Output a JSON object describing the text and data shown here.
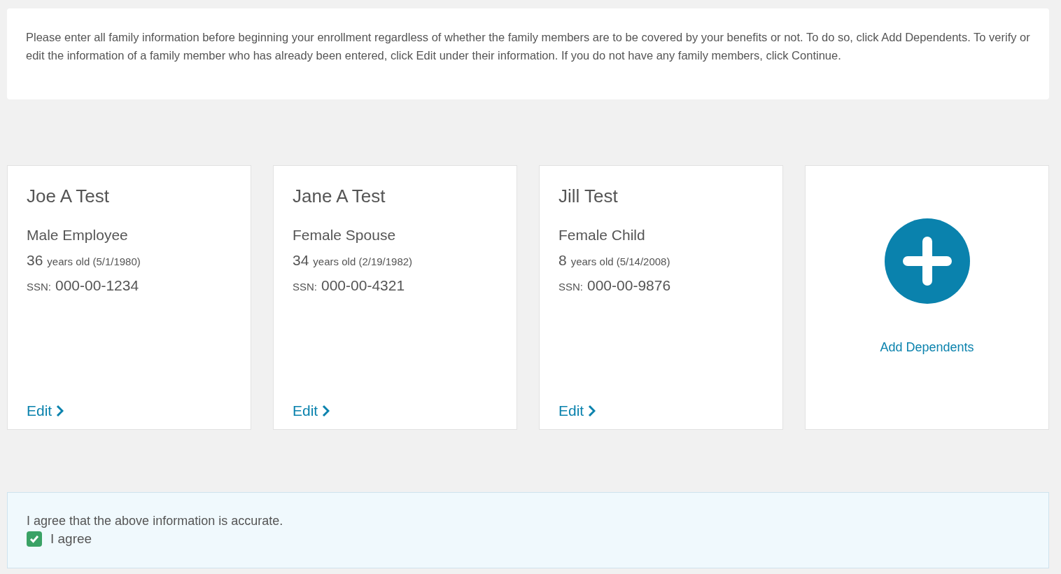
{
  "intro": "Please enter all family information before beginning your enrollment regardless of whether the family members are to be covered by your benefits or not. To do so, click Add Dependents. To verify or edit the information of a family member who has already been entered, click Edit under their information. If you do not have any family members, click Continue.",
  "cards": [
    {
      "kind": "person",
      "name": "Joe A Test",
      "role": "Male Employee",
      "age": "36",
      "age_note": "years old (5/1/1980)",
      "ssn_label": "SSN:",
      "ssn": "000-00-1234",
      "edit": "Edit"
    },
    {
      "kind": "person",
      "name": "Jane A Test",
      "role": "Female Spouse",
      "age": "34",
      "age_note": "years old (2/19/1982)",
      "ssn_label": "SSN:",
      "ssn": "000-00-4321",
      "edit": "Edit"
    },
    {
      "kind": "person",
      "name": "Jill Test",
      "role": "Female Child",
      "age": "8",
      "age_note": "years old (5/14/2008)",
      "ssn_label": "SSN:",
      "ssn": "000-00-9876",
      "edit": "Edit"
    },
    {
      "kind": "add",
      "label": "Add Dependents"
    }
  ],
  "agreement": {
    "statement": "I agree that the above information is accurate.",
    "checkbox": {
      "label": "I agree",
      "checked": true
    }
  }
}
